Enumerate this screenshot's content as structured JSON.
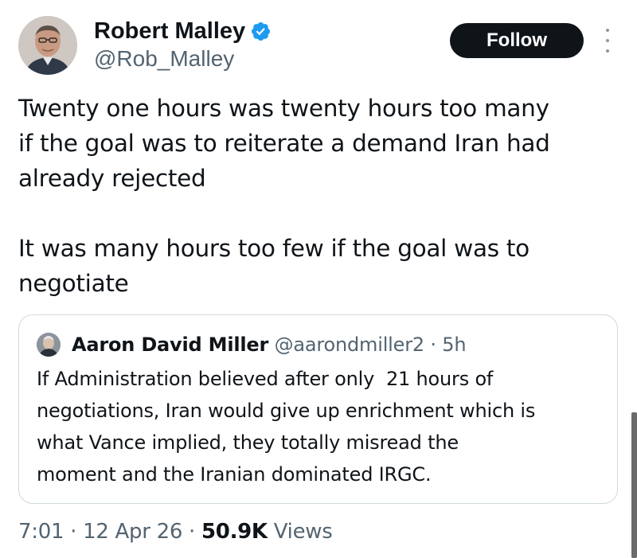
{
  "author": {
    "name": "Robert Malley",
    "handle": "@Rob_Malley",
    "verified": true
  },
  "follow_label": "Follow",
  "tweet_lines": [
    "Twenty one hours was twenty hours too many",
    "if the goal was to reiterate a demand Iran had",
    "already rejected",
    "It was many hours too few if the goal was to",
    "negotiate"
  ],
  "quote": {
    "name": "Aaron David Miller",
    "handle": "@aarondmiller2",
    "separator": "·",
    "time": "5h",
    "lines": [
      "If Administration believed after only  21 hours of",
      "negotiations, Iran would give up enrichment which is",
      "what Vance implied, they totally misread the",
      "moment and the Iranian dominated IRGC."
    ]
  },
  "meta": {
    "time": "7:01",
    "separator": "·",
    "date": "12 Apr 26",
    "views_count": "50.9K",
    "views_label": "Views"
  },
  "colors": {
    "text": "#0f1419",
    "secondary": "#536471",
    "verified_blue": "#1d9bf0",
    "border": "#cfd9de",
    "follow_bg": "#0f1419"
  },
  "icons": {
    "verified": "verified-badge-icon",
    "more": "more-options-icon"
  }
}
